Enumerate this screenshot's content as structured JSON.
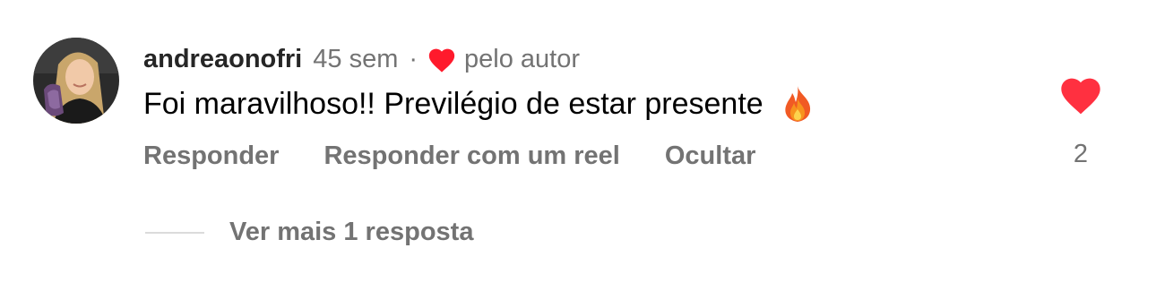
{
  "comment": {
    "username": "andreaonofri",
    "time": "45 sem",
    "separator": "·",
    "author_like_label": "pelo autor",
    "text": "Foi maravilhoso!! Previlégio de estar presente",
    "emoji_icon": "fire-icon",
    "like_count": "2",
    "like_color": "#ff3040",
    "actions": {
      "reply": "Responder",
      "reply_reel": "Responder com um reel",
      "hide": "Ocultar"
    },
    "view_replies": "Ver mais 1 resposta"
  }
}
